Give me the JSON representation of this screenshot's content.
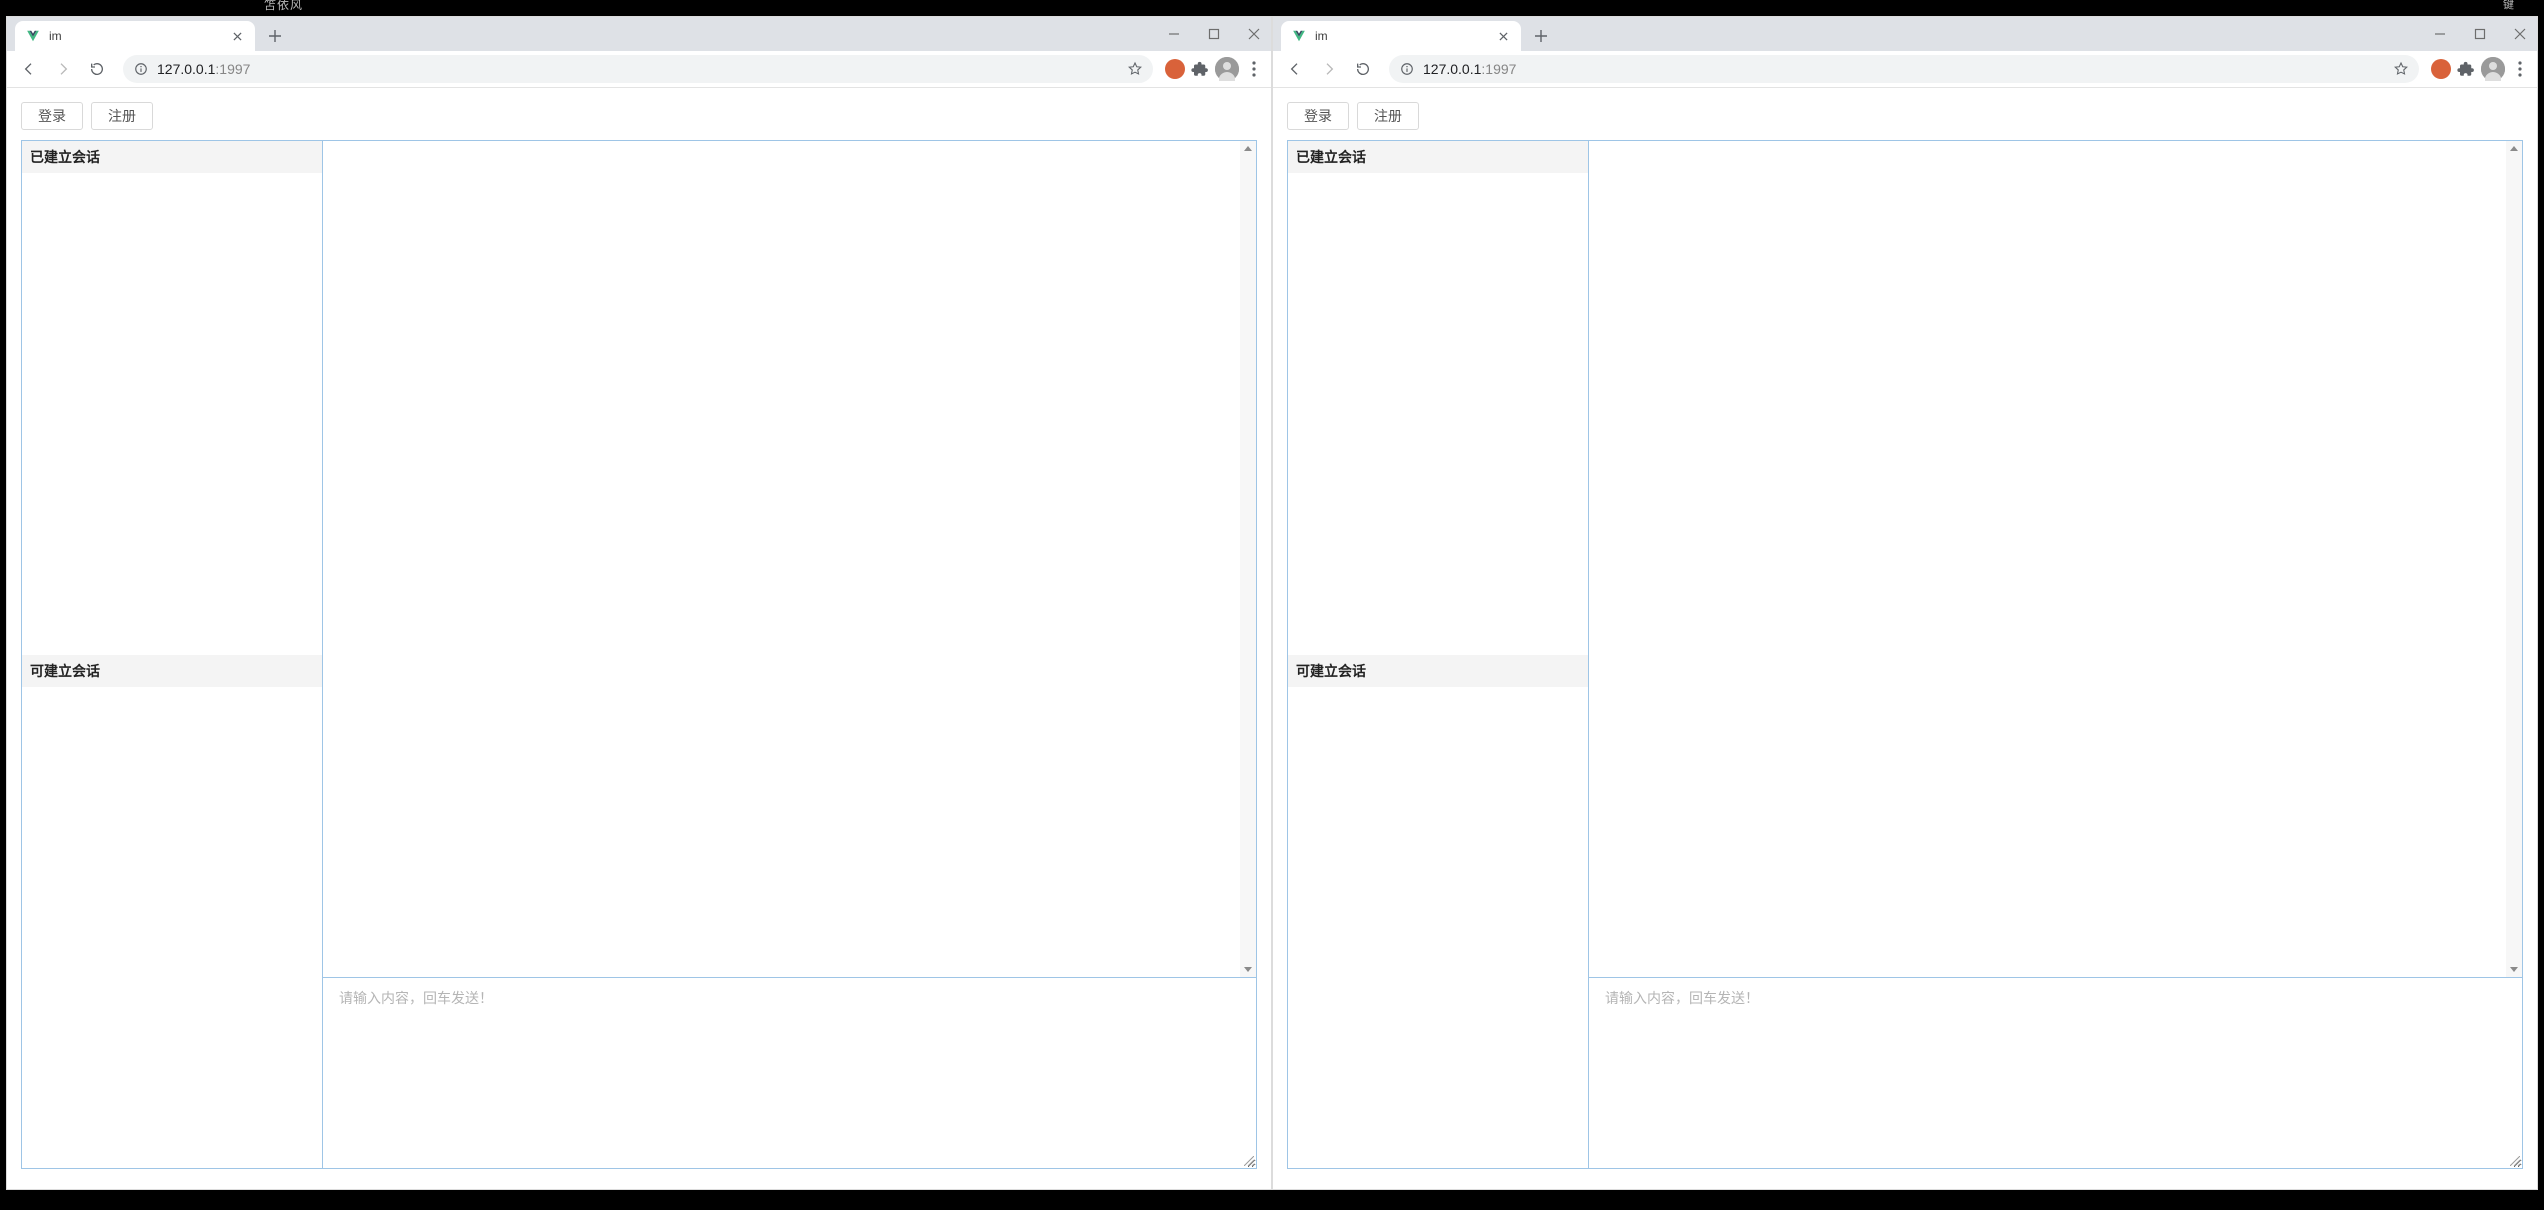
{
  "top_fragment_left": "笘依风",
  "top_fragment_right": "键",
  "windows": [
    {
      "tab": {
        "title": "im"
      },
      "address": {
        "host": "127.0.0.1",
        "port": ":1997"
      },
      "page": {
        "auth": {
          "login": "登录",
          "register": "注册"
        },
        "sidebar": {
          "established": "已建立会话",
          "available": "可建立会话"
        },
        "input_placeholder": "请输入内容，回车发送！"
      }
    },
    {
      "tab": {
        "title": "im"
      },
      "address": {
        "host": "127.0.0.1",
        "port": ":1997"
      },
      "page": {
        "auth": {
          "login": "登录",
          "register": "注册"
        },
        "sidebar": {
          "established": "已建立会话",
          "available": "可建立会话"
        },
        "input_placeholder": "请输入内容，回车发送！"
      }
    }
  ]
}
